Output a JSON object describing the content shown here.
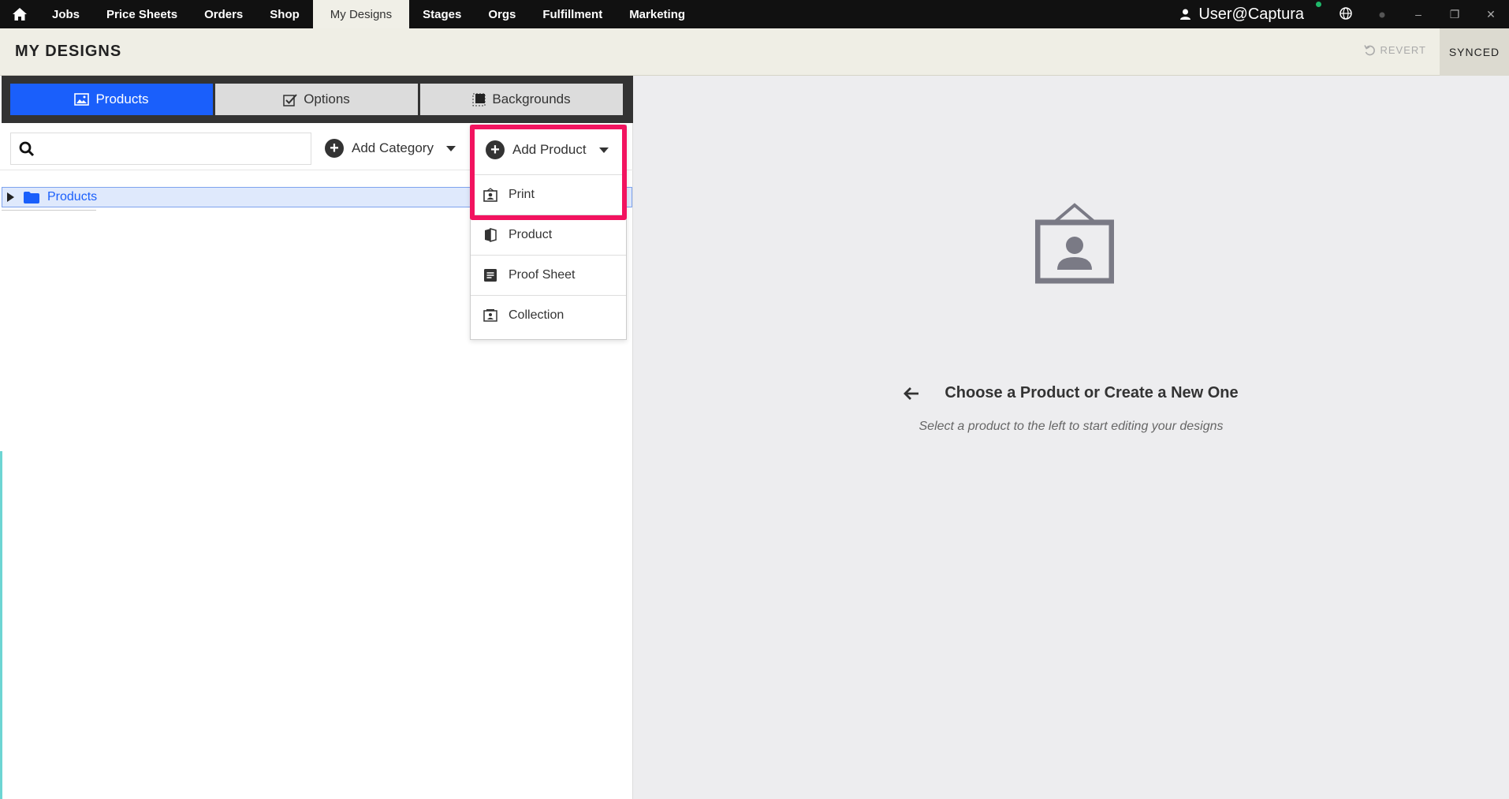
{
  "nav": {
    "items": [
      "Jobs",
      "Price Sheets",
      "Orders",
      "Shop",
      "My Designs",
      "Stages",
      "Orgs",
      "Fulfillment",
      "Marketing"
    ],
    "active": "My Designs",
    "user": "User@Captura",
    "window_controls": [
      "–",
      "❐",
      "✕"
    ]
  },
  "header": {
    "title": "MY DESIGNS",
    "revert_label": "REVERT",
    "synced_label": "SYNCED"
  },
  "tabs": {
    "products": "Products",
    "options": "Options",
    "backgrounds": "Backgrounds"
  },
  "toolbar": {
    "search_placeholder": "",
    "add_category": "Add Category",
    "add_product": "Add Product"
  },
  "tree": {
    "root_label": "Products"
  },
  "dropdown": {
    "items": [
      "Print",
      "Product",
      "Proof Sheet",
      "Collection"
    ]
  },
  "empty_state": {
    "title": "Choose a Product or Create a New One",
    "subtitle": "Select a product to the left to start editing your designs"
  },
  "colors": {
    "accent_blue": "#1a5ffb",
    "highlight": "#f2135f",
    "nav_bg": "#111111"
  }
}
